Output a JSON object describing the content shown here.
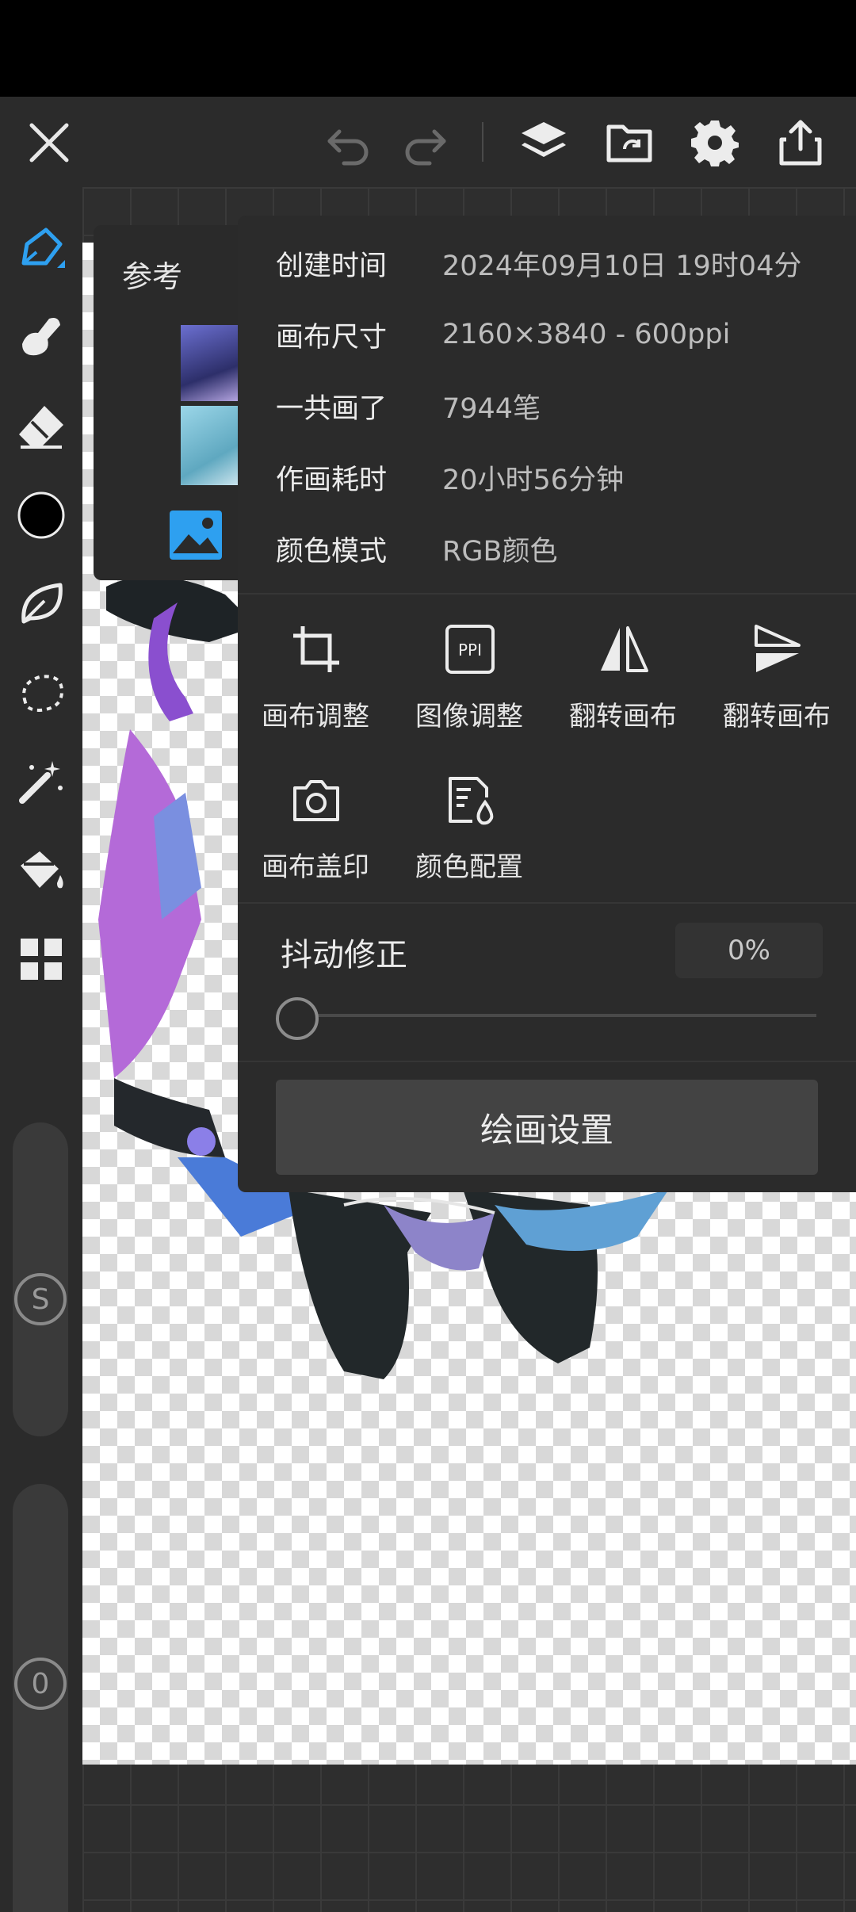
{
  "toolbar": {
    "close_icon": "close-icon",
    "undo_icon": "undo-icon",
    "redo_icon": "redo-icon",
    "layers_icon": "layers-icon",
    "folder_icon": "folder-sync-icon",
    "settings_icon": "gear-icon",
    "share_icon": "share-icon"
  },
  "left_tools": [
    {
      "icon": "pen-icon"
    },
    {
      "icon": "smudge-icon"
    },
    {
      "icon": "eraser-icon"
    },
    {
      "icon": "color-swatch",
      "color": "#000000"
    },
    {
      "icon": "leaf-icon"
    },
    {
      "icon": "lasso-icon"
    },
    {
      "icon": "magic-wand-icon"
    },
    {
      "icon": "fill-bucket-icon"
    },
    {
      "icon": "grid-icon"
    }
  ],
  "size_slider": {
    "label": "S"
  },
  "opacity_slider": {
    "label": "0"
  },
  "reference": {
    "title": "参考"
  },
  "canvas_info": {
    "rows": [
      {
        "label": "创建时间",
        "value": "2024年09月10日 19时04分"
      },
      {
        "label": "画布尺寸",
        "value": "2160×3840 - 600ppi"
      },
      {
        "label": "一共画了",
        "value": "7944笔"
      },
      {
        "label": "作画耗时",
        "value": "20小时56分钟"
      },
      {
        "label": "颜色模式",
        "value": "RGB颜色"
      }
    ]
  },
  "tools": [
    {
      "label": "画布调整",
      "icon": "crop-icon"
    },
    {
      "label": "图像调整",
      "icon": "ppi-icon",
      "icon_text": "PPI"
    },
    {
      "label": "翻转画布",
      "icon": "flip-horizontal-icon"
    },
    {
      "label": "翻转画布",
      "icon": "flip-vertical-icon"
    },
    {
      "label": "画布盖印",
      "icon": "camera-icon"
    },
    {
      "label": "颜色配置",
      "icon": "color-profile-icon"
    }
  ],
  "stabilizer": {
    "label": "抖动修正",
    "value": "0%",
    "level": 0
  },
  "paint_settings": {
    "label": "绘画设置"
  }
}
